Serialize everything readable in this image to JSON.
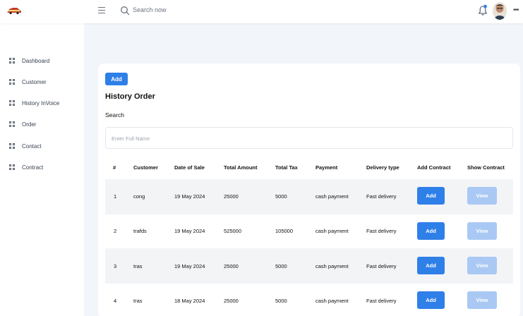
{
  "header": {
    "search_placeholder": "Search now",
    "icons": [
      "logo",
      "menu-icon",
      "search-icon",
      "bell-icon",
      "avatar",
      "more-icon"
    ],
    "notification_dot_color": "#2f7fe8"
  },
  "sidebar": {
    "items": [
      {
        "label": "Dashboard"
      },
      {
        "label": "Customer"
      },
      {
        "label": "History InVoice"
      },
      {
        "label": "Order"
      },
      {
        "label": "Contact"
      },
      {
        "label": "Contract"
      }
    ]
  },
  "main": {
    "add_label": "Add",
    "title": "History Order",
    "search_label": "Search",
    "search_placeholder": "Enter Full Name",
    "columns": [
      "#",
      "Customer",
      "Date of Sale",
      "Total Amount",
      "Total Tax",
      "Payment",
      "Delivery type",
      "Add Contract",
      "Show Contract"
    ],
    "rows": [
      {
        "num": "1",
        "customer": "cong",
        "date": "19 May 2024",
        "amount": "25000",
        "tax": "5000",
        "payment": "cash payment",
        "delivery": "Fast delivery",
        "add": "Add",
        "view": "View"
      },
      {
        "num": "2",
        "customer": "trafds",
        "date": "19 May 2024",
        "amount": "525000",
        "tax": "105000",
        "payment": "cash payment",
        "delivery": "Fast delivery",
        "add": "Add",
        "view": "View"
      },
      {
        "num": "3",
        "customer": "tras",
        "date": "19 May 2024",
        "amount": "25000",
        "tax": "5000",
        "payment": "cash payment",
        "delivery": "Fast delivery",
        "add": "Add",
        "view": "View"
      },
      {
        "num": "4",
        "customer": "tras",
        "date": "18 May 2024",
        "amount": "25000",
        "tax": "5000",
        "payment": "cash payment",
        "delivery": "Fast delivery",
        "add": "Add",
        "view": "View"
      }
    ]
  },
  "colors": {
    "primary": "#2f7fe8",
    "view_button": "#a9c9f4",
    "page_background": "#f2f5fa",
    "row_shade": "#f3f4f6"
  }
}
